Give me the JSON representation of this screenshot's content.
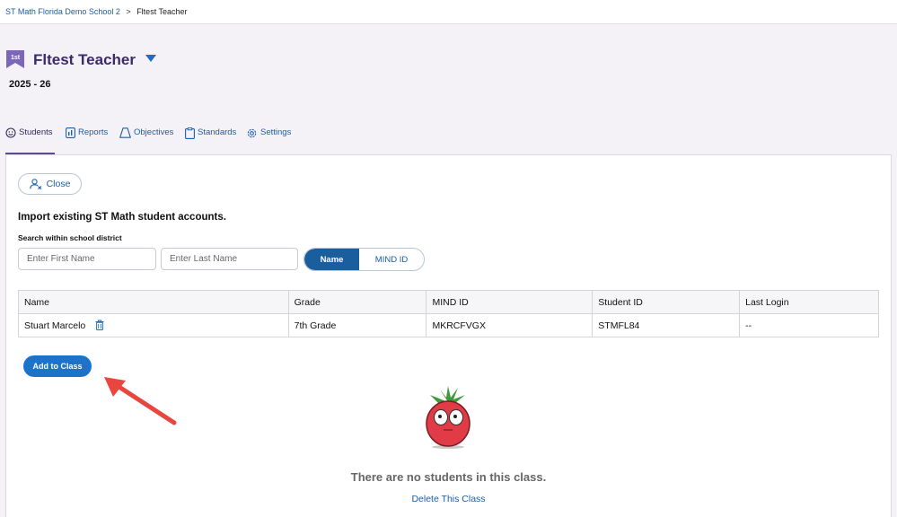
{
  "breadcrumb": {
    "school": "ST Math Florida Demo School 2",
    "separator": ">",
    "current": "Fltest Teacher"
  },
  "class_header": {
    "grade_badge": "1st",
    "title": "Fltest Teacher",
    "year": "2025 - 26"
  },
  "tabs": [
    {
      "label": "Students",
      "icon": "smiley-icon",
      "active": true
    },
    {
      "label": "Reports",
      "icon": "reports-icon",
      "active": false
    },
    {
      "label": "Objectives",
      "icon": "objectives-icon",
      "active": false
    },
    {
      "label": "Standards",
      "icon": "clipboard-icon",
      "active": false
    },
    {
      "label": "Settings",
      "icon": "gear-icon",
      "active": false
    }
  ],
  "import_panel": {
    "close_label": "Close",
    "heading": "Import existing ST Math student accounts.",
    "search_label": "Search within school district",
    "first_name_placeholder": "Enter First Name",
    "last_name_placeholder": "Enter Last Name",
    "toggle": {
      "selected": "Name",
      "other": "MIND ID"
    }
  },
  "table": {
    "columns": [
      "Name",
      "Grade",
      "MIND ID",
      "Student ID",
      "Last Login"
    ],
    "rows": [
      {
        "name": "Stuart Marcelo",
        "grade": "7th Grade",
        "mind_id": "MKRCFVGX",
        "student_id": "STMFL84",
        "last_login": "--"
      }
    ]
  },
  "add_button_label": "Add to Class",
  "empty_state": {
    "message": "There are no students in this class.",
    "delete_label": "Delete This Class"
  },
  "colors": {
    "accent": "#1d73c9",
    "toggle_selected": "#1b5e9e",
    "arrow": "#e8463f",
    "mascot": "#e03b46",
    "title": "#3a2c6b"
  }
}
